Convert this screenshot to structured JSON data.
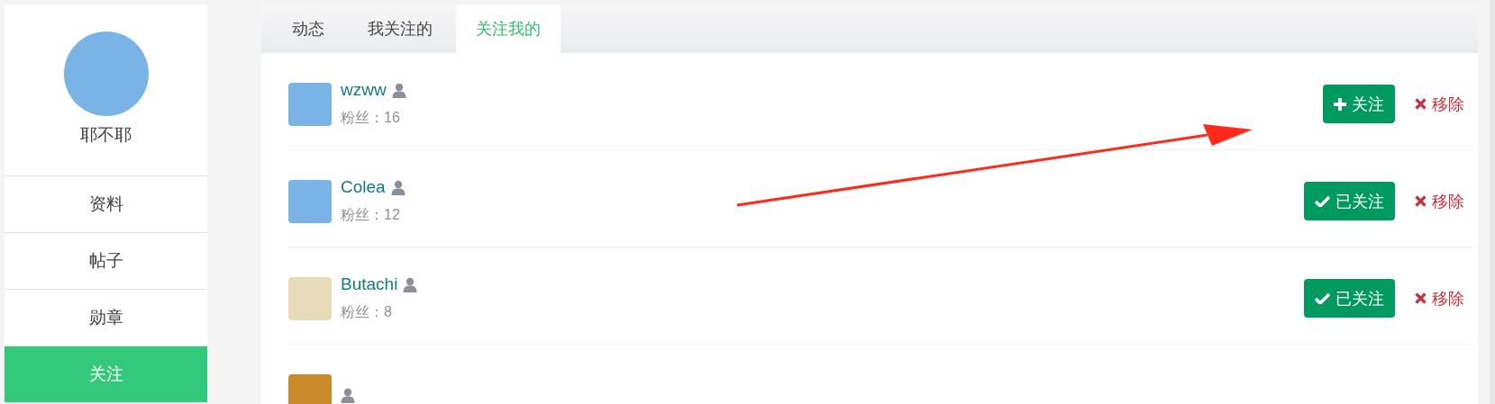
{
  "profile": {
    "name": "耶不耶"
  },
  "menu": [
    {
      "label": "资料",
      "selected": false
    },
    {
      "label": "帖子",
      "selected": false
    },
    {
      "label": "勋章",
      "selected": false
    },
    {
      "label": "关注",
      "selected": true
    }
  ],
  "tabs": [
    {
      "label": "动态",
      "selected": false
    },
    {
      "label": "我关注的",
      "selected": false
    },
    {
      "label": "关注我的",
      "selected": true
    }
  ],
  "users": [
    {
      "name": "wzww",
      "fans": "粉丝：16",
      "followed": false,
      "follow_label": "关注",
      "remove_label": "移除",
      "color": "#7ab3e6"
    },
    {
      "name": "Colea",
      "fans": "粉丝：12",
      "followed": true,
      "follow_label": "已关注",
      "remove_label": "移除",
      "color": "#7ab3e6"
    },
    {
      "name": "Butachi",
      "fans": "粉丝：8",
      "followed": true,
      "follow_label": "已关注",
      "remove_label": "移除",
      "color": "#e8dcb8"
    },
    {
      "color": "#c98a2a"
    }
  ]
}
